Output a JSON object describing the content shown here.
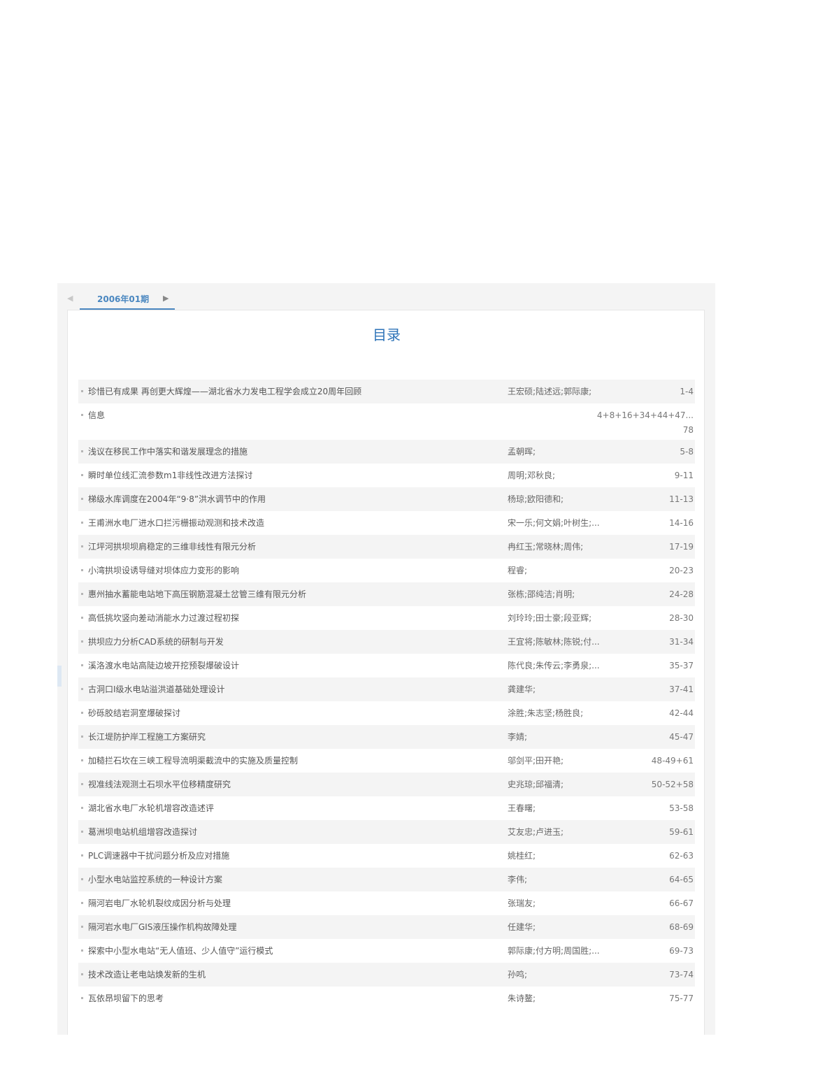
{
  "tabs": {
    "prev_glyph": "◀",
    "next_glyph": "▶",
    "current_issue": "2006年01期"
  },
  "heading": "目录",
  "articles": [
    {
      "title": "珍惜已有成果 再创更大辉煌——湖北省水力发电工程学会成立20周年回顾",
      "authors": "王宏硕;陆述远;郭际康;",
      "pages": "1-4"
    },
    {
      "title": "信息",
      "authors": "",
      "pages": "4+8+16+34+44+47...78"
    },
    {
      "title": "浅议在移民工作中落实和谐发展理念的措施",
      "authors": "孟朝晖;",
      "pages": "5-8"
    },
    {
      "title": "瞬时单位线汇流参数m1非线性改进方法探讨",
      "authors": "周明;邓秋良;",
      "pages": "9-11"
    },
    {
      "title": "梯级水库调度在2004年“9·8”洪水调节中的作用",
      "authors": "杨琼;欧阳德和;",
      "pages": "11-13"
    },
    {
      "title": "王甫洲水电厂进水口拦污栅振动观测和技术改造",
      "authors": "宋一乐;何文娟;叶树生;...",
      "pages": "14-16"
    },
    {
      "title": "江坪河拱坝坝肩稳定的三维非线性有限元分析",
      "authors": "冉红玉;常晓林;周伟;",
      "pages": "17-19"
    },
    {
      "title": "小湾拱坝设诱导缝对坝体应力变形的影响",
      "authors": "程睿;",
      "pages": "20-23"
    },
    {
      "title": "惠州抽水蓄能电站地下高压钢筋混凝土岔管三维有限元分析",
      "authors": "张栋;邵纯洁;肖明;",
      "pages": "24-28"
    },
    {
      "title": "高低挑坎竖向差动消能水力过渡过程初探",
      "authors": "刘玲玲;田士豪;段亚辉;",
      "pages": "28-30"
    },
    {
      "title": "拱坝应力分析CAD系统的研制与开发",
      "authors": "王宜将;陈敏林;陈锐;付...",
      "pages": "31-34"
    },
    {
      "title": "溪洛渡水电站高陡边坡开挖预裂爆破设计",
      "authors": "陈代良;朱传云;李勇泉;...",
      "pages": "35-37"
    },
    {
      "title": "古洞口Ⅰ级水电站溢洪道基础处理设计",
      "authors": "龚建华;",
      "pages": "37-41"
    },
    {
      "title": "砂砾胶结岩洞室爆破探讨",
      "authors": "涂胜;朱志坚;杨胜良;",
      "pages": "42-44"
    },
    {
      "title": "长江堤防护岸工程施工方案研究",
      "authors": "李婧;",
      "pages": "45-47"
    },
    {
      "title": "加糙拦石坎在三峡工程导流明渠截流中的实施及质量控制",
      "authors": "邬剑平;田开艳;",
      "pages": "48-49+61"
    },
    {
      "title": "视准线法观测土石坝水平位移精度研究",
      "authors": "史兆琼;邱福清;",
      "pages": "50-52+58"
    },
    {
      "title": "湖北省水电厂水轮机增容改造述评",
      "authors": "王春曙;",
      "pages": "53-58"
    },
    {
      "title": "葛洲坝电站机组增容改造探讨",
      "authors": "艾友忠;卢进玉;",
      "pages": "59-61"
    },
    {
      "title": "PLC调速器中干扰问题分析及应对措施",
      "authors": "姚桂红;",
      "pages": "62-63"
    },
    {
      "title": "小型水电站监控系统的一种设计方案",
      "authors": "李伟;",
      "pages": "64-65"
    },
    {
      "title": "隔河岩电厂水轮机裂纹成因分析与处理",
      "authors": "张瑞友;",
      "pages": "66-67"
    },
    {
      "title": "隔河岩水电厂GIS液压操作机构故障处理",
      "authors": "任建华;",
      "pages": "68-69"
    },
    {
      "title": "探索中小型水电站“无人值班、少人值守”运行模式",
      "authors": "郭际康;付方明;周国胜;...",
      "pages": "69-73"
    },
    {
      "title": "技术改造让老电站焕发新的生机",
      "authors": "孙鸣;",
      "pages": "73-74"
    },
    {
      "title": "瓦依昂坝留下的思考",
      "authors": "朱诗鳌;",
      "pages": "75-77"
    }
  ]
}
